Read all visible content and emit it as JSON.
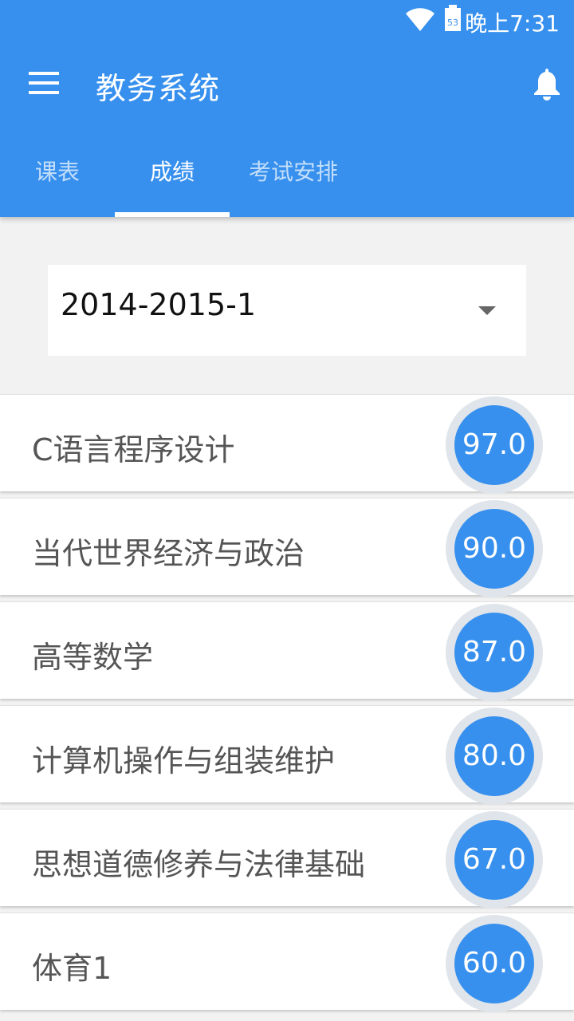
{
  "status_bar": {
    "time": "晚上7:31",
    "battery_level": "53"
  },
  "header": {
    "title": "教务系统"
  },
  "tabs": [
    {
      "label": "课表"
    },
    {
      "label": "成绩",
      "active": true
    },
    {
      "label": "考试安排"
    }
  ],
  "term_selector": {
    "value": "2014-2015-1"
  },
  "grades": [
    {
      "course": "C语言程序设计",
      "score": "97.0"
    },
    {
      "course": "当代世界经济与政治",
      "score": "90.0"
    },
    {
      "course": "高等数学",
      "score": "87.0"
    },
    {
      "course": "计算机操作与组装维护",
      "score": "80.0"
    },
    {
      "course": "思想道德修养与法律基础",
      "score": "67.0"
    },
    {
      "course": "体育1",
      "score": "60.0"
    }
  ],
  "colors": {
    "primary": "#3790ee",
    "ring": "#dfe5ea",
    "background": "#f2f2f2"
  },
  "icons": [
    "wifi-icon",
    "battery-icon",
    "menu-icon",
    "bell-icon",
    "dropdown-arrow-icon"
  ]
}
